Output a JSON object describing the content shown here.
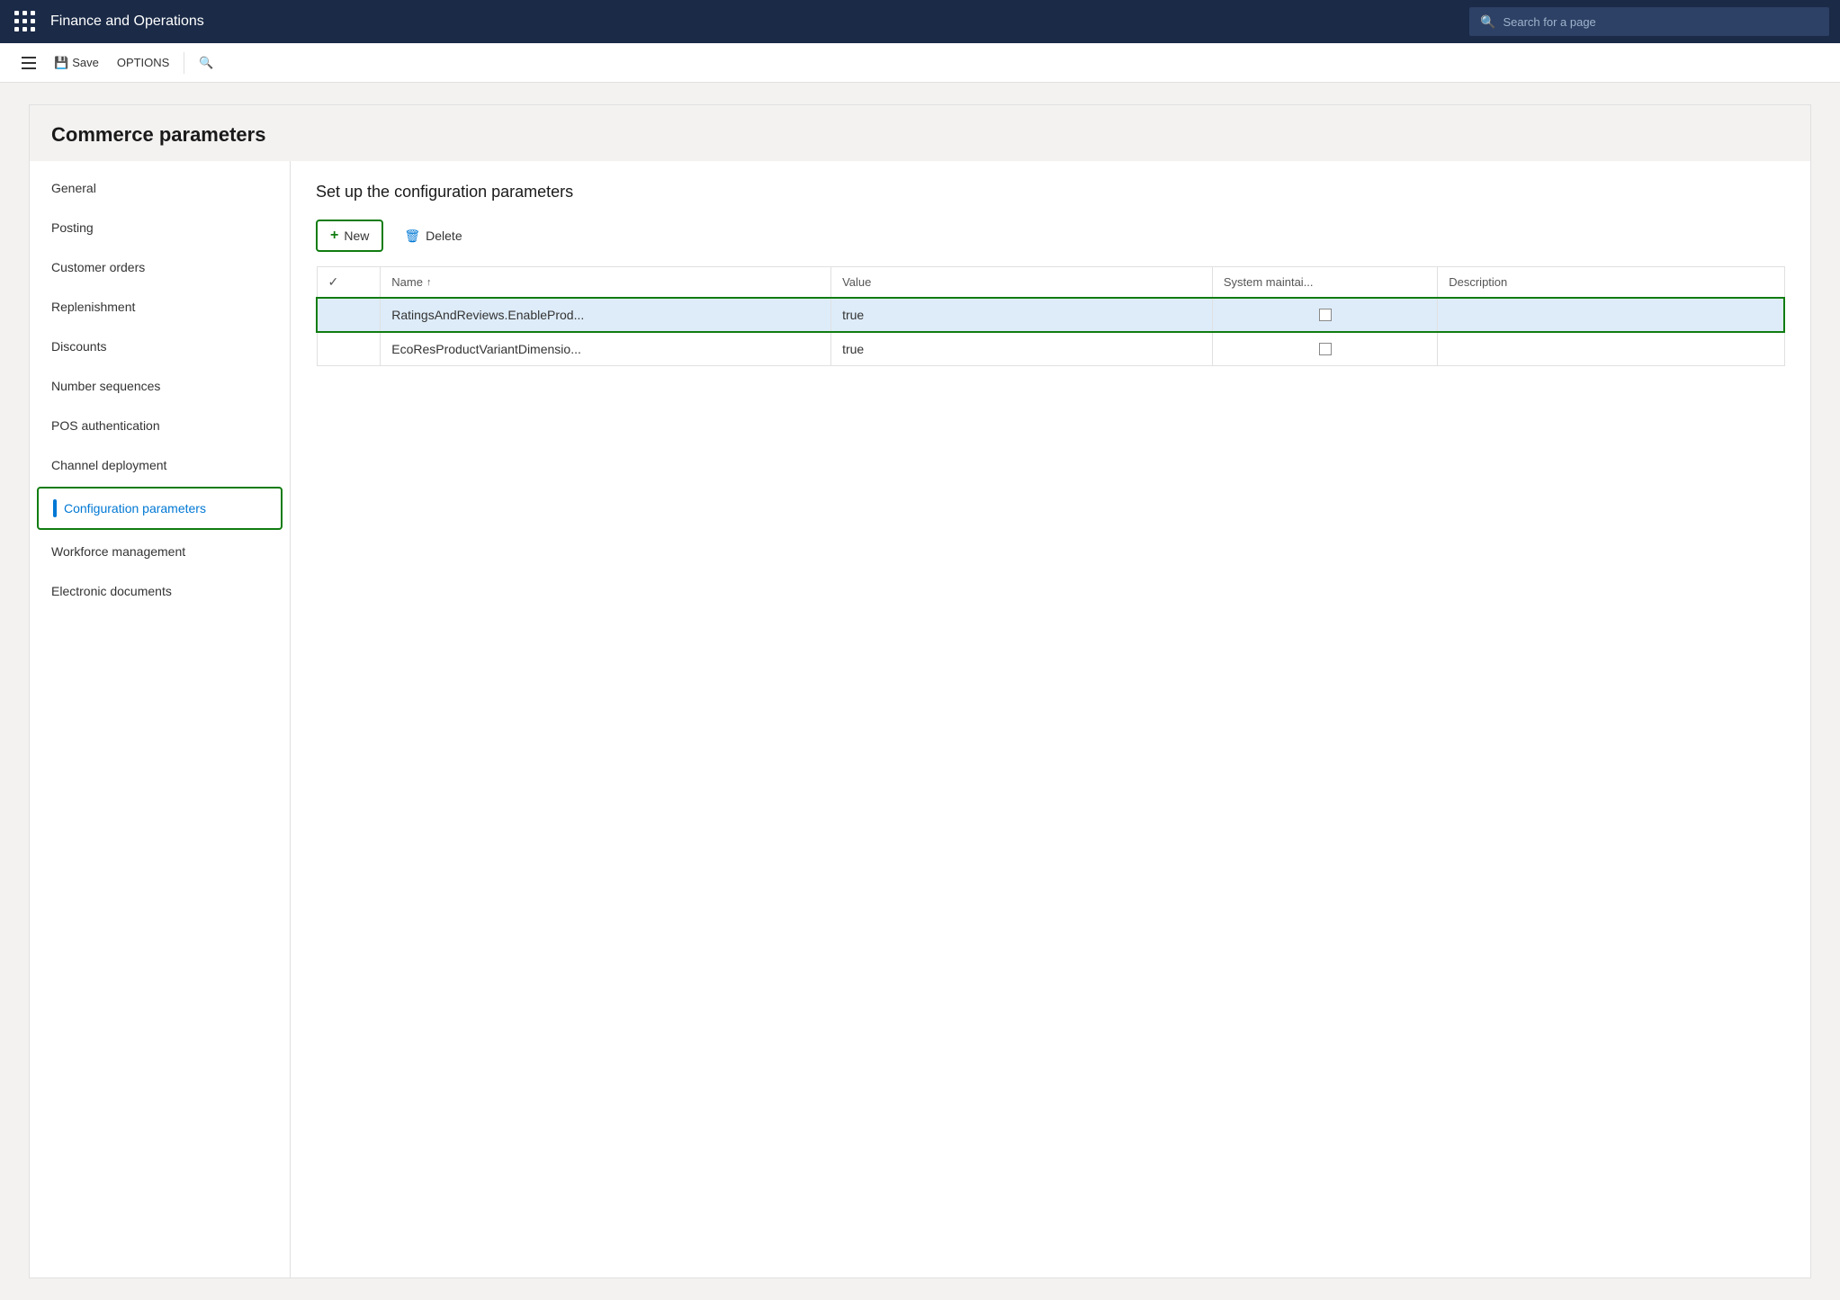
{
  "topbar": {
    "title": "Finance and Operations",
    "search_placeholder": "Search for a page"
  },
  "toolbar": {
    "save_label": "Save",
    "options_label": "OPTIONS"
  },
  "page": {
    "title": "Commerce parameters"
  },
  "sidebar": {
    "items": [
      {
        "id": "general",
        "label": "General",
        "active": false
      },
      {
        "id": "posting",
        "label": "Posting",
        "active": false
      },
      {
        "id": "customer-orders",
        "label": "Customer orders",
        "active": false
      },
      {
        "id": "replenishment",
        "label": "Replenishment",
        "active": false
      },
      {
        "id": "discounts",
        "label": "Discounts",
        "active": false
      },
      {
        "id": "number-sequences",
        "label": "Number sequences",
        "active": false
      },
      {
        "id": "pos-authentication",
        "label": "POS authentication",
        "active": false
      },
      {
        "id": "channel-deployment",
        "label": "Channel deployment",
        "active": false
      },
      {
        "id": "configuration-parameters",
        "label": "Configuration parameters",
        "active": true
      },
      {
        "id": "workforce-management",
        "label": "Workforce management",
        "active": false
      },
      {
        "id": "electronic-documents",
        "label": "Electronic documents",
        "active": false
      }
    ]
  },
  "main": {
    "section_title": "Set up the configuration parameters",
    "new_button": "+ New",
    "new_label": "New",
    "delete_label": "Delete",
    "table": {
      "columns": [
        {
          "id": "check",
          "label": ""
        },
        {
          "id": "name",
          "label": "Name",
          "sortable": true
        },
        {
          "id": "value",
          "label": "Value"
        },
        {
          "id": "sysmaint",
          "label": "System maintai..."
        },
        {
          "id": "description",
          "label": "Description"
        }
      ],
      "rows": [
        {
          "id": 1,
          "selected": true,
          "name": "RatingsAndReviews.EnableProd...",
          "value": "true",
          "sysmaint": false,
          "description": ""
        },
        {
          "id": 2,
          "selected": false,
          "name": "EcoResProductVariantDimensio...",
          "value": "true",
          "sysmaint": false,
          "description": ""
        }
      ]
    }
  },
  "icons": {
    "grid": "⊞",
    "save": "💾",
    "search": "🔍",
    "plus": "+",
    "trash": "🗑",
    "sort_asc": "↑"
  }
}
